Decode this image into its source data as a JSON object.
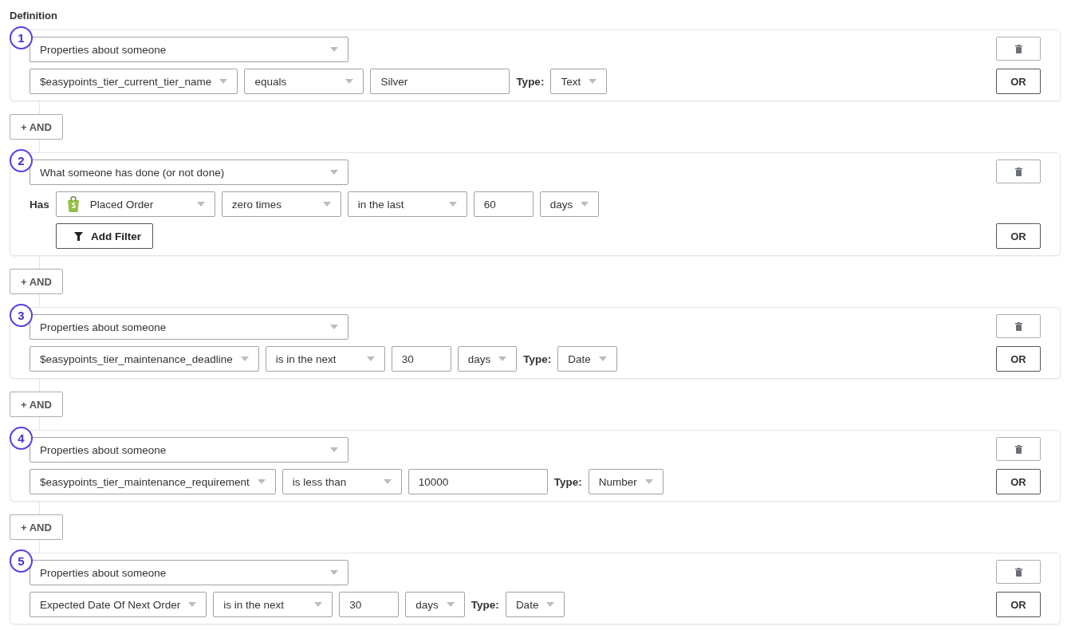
{
  "heading": "Definition",
  "conditions": [
    {
      "number": "1",
      "type": "Properties about someone",
      "fields": [
        {
          "kind": "select",
          "text": "$easypoints_tier_current_tier_name"
        },
        {
          "kind": "select",
          "text": "equals"
        },
        {
          "kind": "input",
          "text": "Silver"
        },
        {
          "kind": "label",
          "text": "Type:"
        },
        {
          "kind": "select",
          "text": "Text"
        }
      ],
      "or": "OR",
      "and_button": "+ AND"
    },
    {
      "number": "2",
      "type": "What someone has done (or not done)",
      "fields": [
        {
          "kind": "label",
          "text": "Has"
        },
        {
          "kind": "event",
          "text": "Placed Order"
        },
        {
          "kind": "select",
          "text": "zero times"
        },
        {
          "kind": "select",
          "text": "in the last"
        },
        {
          "kind": "input",
          "text": "60"
        },
        {
          "kind": "select",
          "text": "days"
        }
      ],
      "add_filter": "Add Filter",
      "or": "OR",
      "and_button": "+ AND"
    },
    {
      "number": "3",
      "type": "Properties about someone",
      "fields": [
        {
          "kind": "select",
          "text": "$easypoints_tier_maintenance_deadline"
        },
        {
          "kind": "select",
          "text": "is in the next"
        },
        {
          "kind": "input",
          "text": "30"
        },
        {
          "kind": "select",
          "text": "days"
        },
        {
          "kind": "label",
          "text": "Type:"
        },
        {
          "kind": "select",
          "text": "Date"
        }
      ],
      "or": "OR",
      "and_button": "+ AND"
    },
    {
      "number": "4",
      "type": "Properties about someone",
      "fields": [
        {
          "kind": "select",
          "text": "$easypoints_tier_maintenance_requirement"
        },
        {
          "kind": "select",
          "text": "is less than"
        },
        {
          "kind": "input",
          "text": "10000"
        },
        {
          "kind": "label",
          "text": "Type:"
        },
        {
          "kind": "select",
          "text": "Number"
        }
      ],
      "or": "OR",
      "and_button": "+ AND"
    },
    {
      "number": "5",
      "type": "Properties about someone",
      "fields": [
        {
          "kind": "select",
          "text": "Expected Date Of Next Order"
        },
        {
          "kind": "select",
          "text": "is in the next"
        },
        {
          "kind": "input",
          "text": "30"
        },
        {
          "kind": "select",
          "text": "days"
        },
        {
          "kind": "label",
          "text": "Type:"
        },
        {
          "kind": "select",
          "text": "Date"
        }
      ],
      "or": "OR"
    }
  ]
}
